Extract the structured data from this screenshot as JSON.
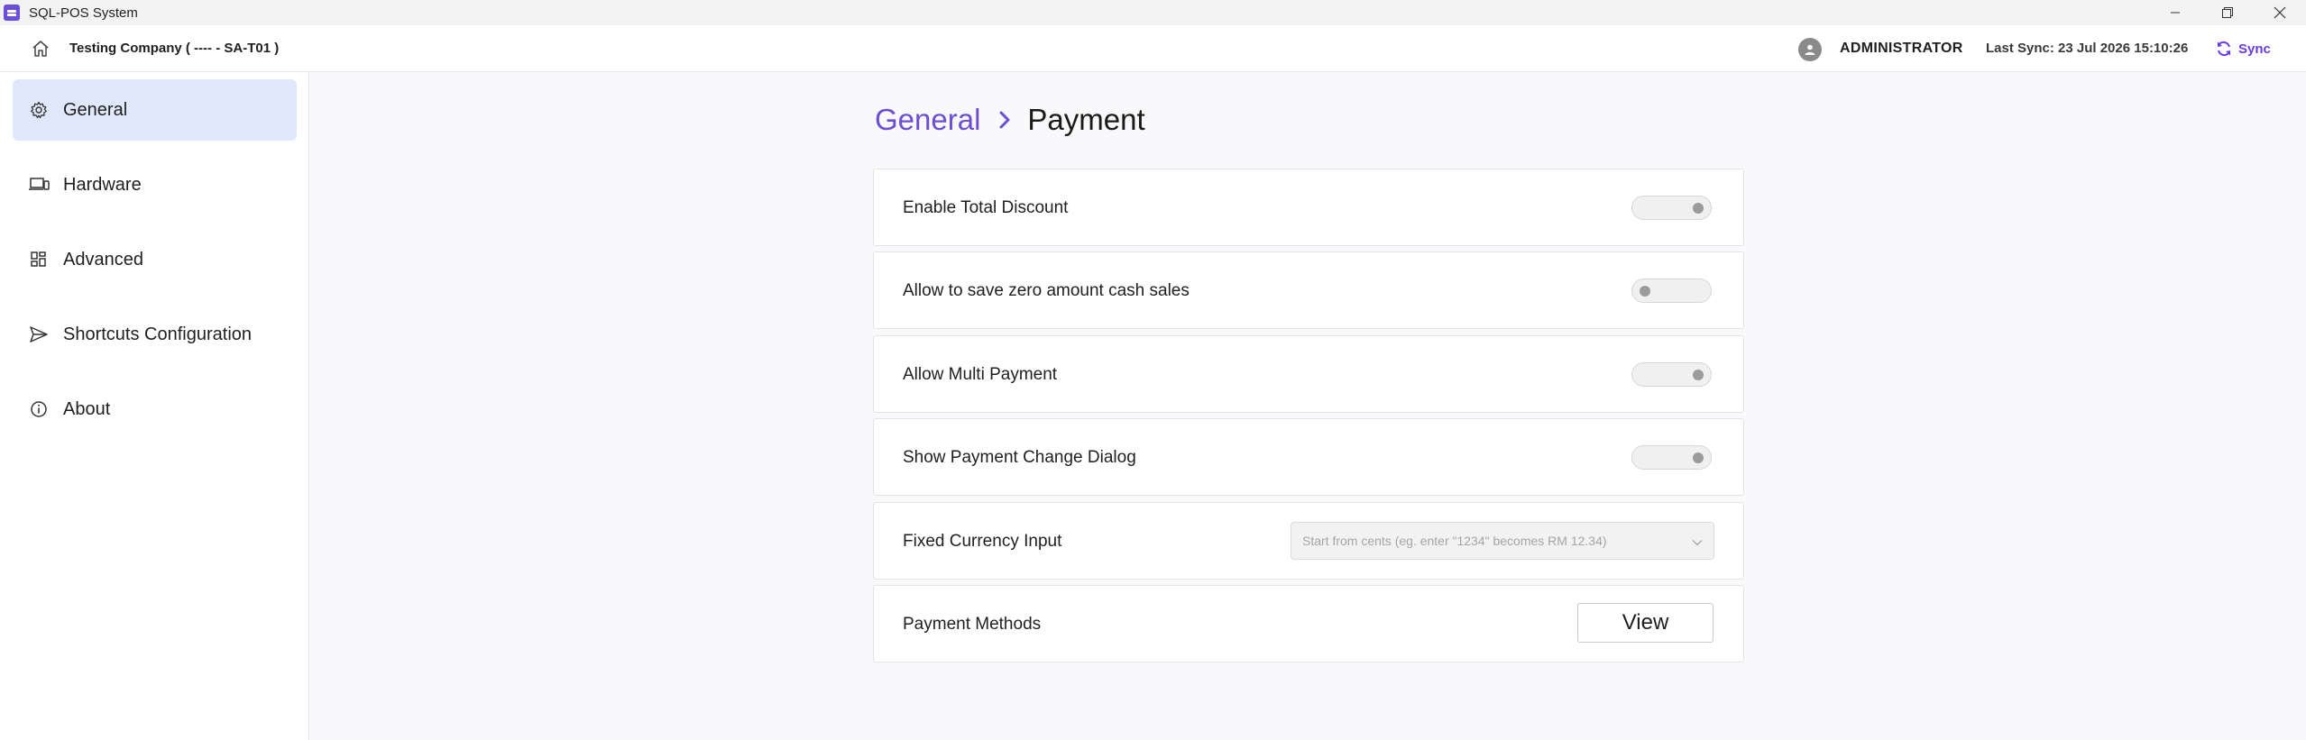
{
  "window": {
    "title": "SQL-POS System"
  },
  "header": {
    "company": "Testing Company ( ---- - SA-T01 )",
    "user": "ADMINISTRATOR",
    "last_sync": "Last Sync: 23 Jul 2026 15:10:26",
    "sync_label": "Sync"
  },
  "sidebar": {
    "items": [
      {
        "label": "General",
        "icon": "gear-icon",
        "active": true
      },
      {
        "label": "Hardware",
        "icon": "devices-icon",
        "active": false
      },
      {
        "label": "Advanced",
        "icon": "grid-icon",
        "active": false
      },
      {
        "label": "Shortcuts Configuration",
        "icon": "send-icon",
        "active": false
      },
      {
        "label": "About",
        "icon": "info-icon",
        "active": false
      }
    ]
  },
  "breadcrumb": {
    "parent": "General",
    "current": "Payment"
  },
  "settings": [
    {
      "label": "Enable Total Discount",
      "type": "toggle",
      "knob": "right"
    },
    {
      "label": "Allow to save zero amount cash sales",
      "type": "toggle",
      "knob": "left"
    },
    {
      "label": "Allow Multi Payment",
      "type": "toggle",
      "knob": "right"
    },
    {
      "label": "Show Payment Change Dialog",
      "type": "toggle",
      "knob": "right"
    },
    {
      "label": "Fixed Currency Input",
      "type": "select",
      "value": "Start from cents (eg. enter \"1234\" becomes RM 12.34)"
    },
    {
      "label": "Payment Methods",
      "type": "button",
      "button_label": "View"
    }
  ],
  "colors": {
    "accent": "#6a4fd0",
    "sync": "#6a3be0",
    "active_nav": "#dfe9fb"
  }
}
